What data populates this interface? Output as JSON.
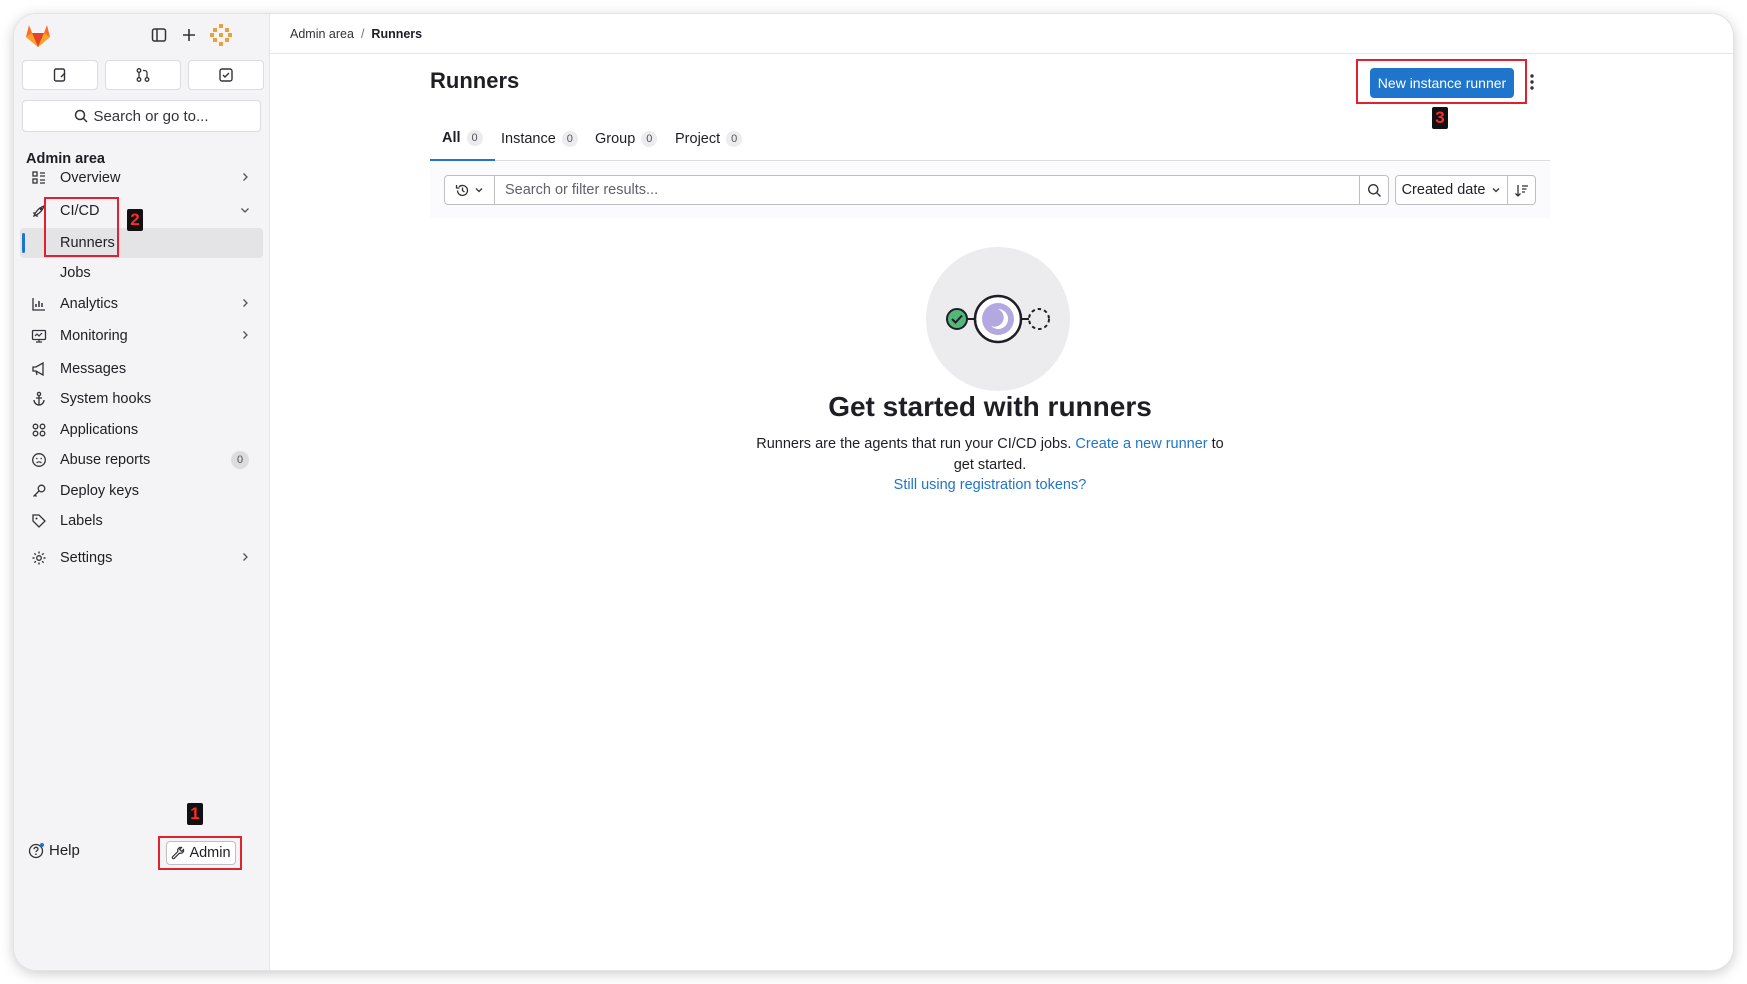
{
  "sidebar": {
    "heading": "Admin area",
    "search_label": "Search or go to...",
    "items": [
      {
        "label": "Overview"
      },
      {
        "label": "CI/CD"
      },
      {
        "label": "Runners"
      },
      {
        "label": "Jobs"
      },
      {
        "label": "Analytics"
      },
      {
        "label": "Monitoring"
      },
      {
        "label": "Messages"
      },
      {
        "label": "System hooks"
      },
      {
        "label": "Applications"
      },
      {
        "label": "Abuse reports",
        "count": "0"
      },
      {
        "label": "Deploy keys"
      },
      {
        "label": "Labels"
      },
      {
        "label": "Settings"
      }
    ],
    "help_label": "Help",
    "admin_label": "Admin"
  },
  "breadcrumb": {
    "parent": "Admin area",
    "separator": "/",
    "current": "Runners"
  },
  "page": {
    "title": "Runners",
    "primary_button": "New instance runner"
  },
  "tabs": [
    {
      "label": "All",
      "count": "0"
    },
    {
      "label": "Instance",
      "count": "0"
    },
    {
      "label": "Group",
      "count": "0"
    },
    {
      "label": "Project",
      "count": "0"
    }
  ],
  "filter": {
    "placeholder": "Search or filter results...",
    "sort_label": "Created date"
  },
  "empty_state": {
    "title": "Get started with runners",
    "description_before": "Runners are the agents that run your CI/CD jobs. ",
    "description_link": "Create a new runner",
    "description_after": " to get started.",
    "secondary_link": "Still using registration tokens?"
  },
  "annotations": {
    "step1": "1",
    "step2": "2",
    "step3": "3"
  },
  "colors": {
    "accent": "#1f75cb",
    "annotation": "#e0212f",
    "sidebar_bg": "#f4f4f6"
  }
}
